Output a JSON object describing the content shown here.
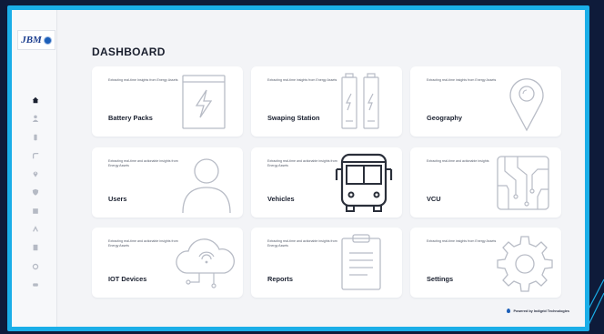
{
  "app": {
    "logo_text": "JBM",
    "footer_text": "Powered by Indigrid Technologies"
  },
  "page": {
    "title": "DASHBOARD"
  },
  "nav": [
    {
      "name": "home",
      "icon": "home-icon",
      "active": true
    },
    {
      "name": "user",
      "icon": "user-icon"
    },
    {
      "name": "battery",
      "icon": "battery-icon"
    },
    {
      "name": "route",
      "icon": "route-icon"
    },
    {
      "name": "location",
      "icon": "location-pin-icon"
    },
    {
      "name": "shield",
      "icon": "shield-icon"
    },
    {
      "name": "grid",
      "icon": "grid-icon"
    },
    {
      "name": "bars",
      "icon": "bars-icon"
    },
    {
      "name": "document",
      "icon": "document-icon"
    },
    {
      "name": "settings",
      "icon": "gear-icon"
    },
    {
      "name": "logout",
      "icon": "logout-icon"
    }
  ],
  "cards": [
    {
      "name": "Battery Packs",
      "desc": "Extracting real-time Insights from Energy Assets",
      "icon": "battery-pack-icon"
    },
    {
      "name": "Swaping Station",
      "desc": "Extracting real-time insights from Energy Assets",
      "icon": "swapping-station-icon"
    },
    {
      "name": "Geography",
      "desc": "Extracting real-time insights from Energy Assets",
      "icon": "map-pin-icon"
    },
    {
      "name": "Users",
      "desc": "Extracting real-time and actionable insights from Energy Assets",
      "icon": "user-icon"
    },
    {
      "name": "Vehicles",
      "desc": "Extracting real-time and actionable insights from Energy Assets",
      "icon": "bus-icon"
    },
    {
      "name": "VCU",
      "desc": "Extracting real-time and actionable insights",
      "icon": "circuit-icon"
    },
    {
      "name": "IOT Devices",
      "desc": "Extracting real-time and actionable insights from Energy Assets",
      "icon": "cloud-iot-icon"
    },
    {
      "name": "Reports",
      "desc": "Extracting real-time and actionable insights from Energy Assets",
      "icon": "clipboard-icon"
    },
    {
      "name": "Settings",
      "desc": "Extracting real-time insights from Energy Assets",
      "icon": "gear-icon"
    }
  ],
  "colors": {
    "frame": "#1aaee8",
    "background": "#f3f4f7",
    "card": "#ffffff",
    "icon_stroke": "#b8bcc6",
    "icon_dark": "#2a2f3a"
  }
}
